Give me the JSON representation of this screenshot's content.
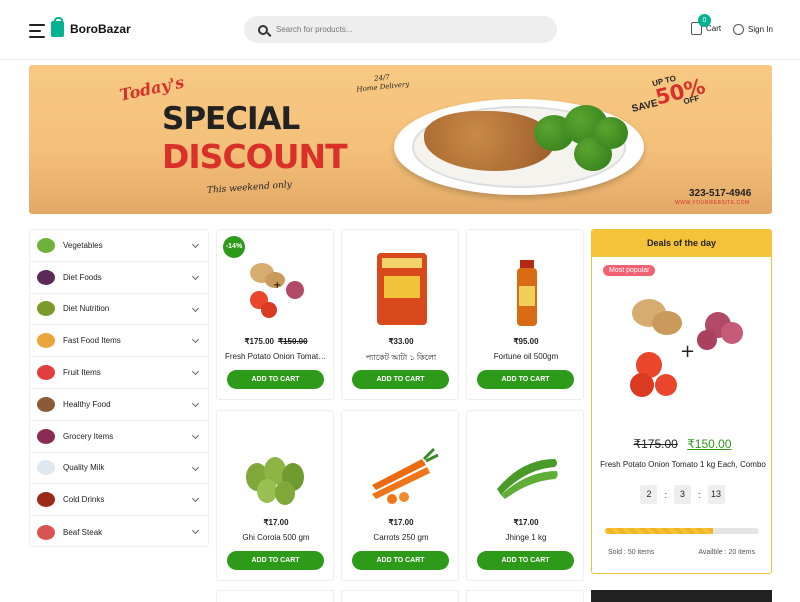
{
  "header": {
    "brand": "BoroBazar",
    "search_placeholder": "Search for products...",
    "cart_count": "0",
    "cart_label": "Cart",
    "signin_label": "Sign In"
  },
  "banner": {
    "todays": "Today's",
    "special": "SPECIAL",
    "discount": "DISCOUNT",
    "weekend": "This weekend only",
    "delivery_line1": "24/7",
    "delivery_line2": "Home Delivery",
    "save_up_to": "UP TO",
    "save_label": "SAVE",
    "save_percent": "50%",
    "save_off": "OFF",
    "phone": "323-517-4946",
    "website": "WWW.YOURWEBSITE.COM"
  },
  "categories": [
    {
      "label": "Vegetables",
      "icon": "vegetables-icon",
      "color": "#6fb13a"
    },
    {
      "label": "Diet Foods",
      "icon": "eggplant-icon",
      "color": "#5b2a5a"
    },
    {
      "label": "Diet Nutrition",
      "icon": "avocado-icon",
      "color": "#7a9a2a"
    },
    {
      "label": "Fast Food Items",
      "icon": "fastfood-icon",
      "color": "#e9a53a"
    },
    {
      "label": "Fruit Items",
      "icon": "watermelon-icon",
      "color": "#e23d3d"
    },
    {
      "label": "Healthy Food",
      "icon": "coconut-icon",
      "color": "#8a5a34"
    },
    {
      "label": "Grocery Items",
      "icon": "onion-icon",
      "color": "#8b2a52"
    },
    {
      "label": "Quality Milk",
      "icon": "milk-icon",
      "color": "#dfe8f1"
    },
    {
      "label": "Cold Drinks",
      "icon": "drink-icon",
      "color": "#9b2a1a"
    },
    {
      "label": "Beaf Steak",
      "icon": "steak-icon",
      "color": "#d9534f"
    }
  ],
  "products": [
    {
      "price": "₹175.00",
      "old_price": "₹150.00",
      "name": "Fresh Potato Onion Tomato 1 kg Each, Combo",
      "button": "ADD TO CART",
      "badge": "-14%"
    },
    {
      "price": "₹33.00",
      "name": "প্যাকেট আটা ১ কিলো",
      "button": "ADD TO CART"
    },
    {
      "price": "₹95.00",
      "name": "Fortune oil 500gm",
      "button": "ADD TO CART"
    },
    {
      "price": "₹17.00",
      "name": "Ghi Corola 500 gm",
      "button": "ADD TO CART"
    },
    {
      "price": "₹17.00",
      "name": "Carrots 250 gm",
      "button": "ADD TO CART"
    },
    {
      "price": "₹17.00",
      "name": "Jhinge 1 kg",
      "button": "ADD TO CART"
    }
  ],
  "deals": {
    "title": "Deals of the day",
    "badge": "Most popular",
    "old_price": "₹175.00",
    "new_price": "₹150.00",
    "name": "Fresh Potato Onion Tomato 1 kg Each, Combo",
    "timer": [
      "2",
      "3",
      "13"
    ],
    "timer_sep": ":",
    "progress": 0.7,
    "sold": "Sold : 50 items",
    "available": "Availble : 20 items"
  },
  "colors": {
    "brand": "#02b290",
    "button": "#2e9a1a",
    "deal_header": "#f5c33a",
    "badge_pink": "#f06272"
  }
}
